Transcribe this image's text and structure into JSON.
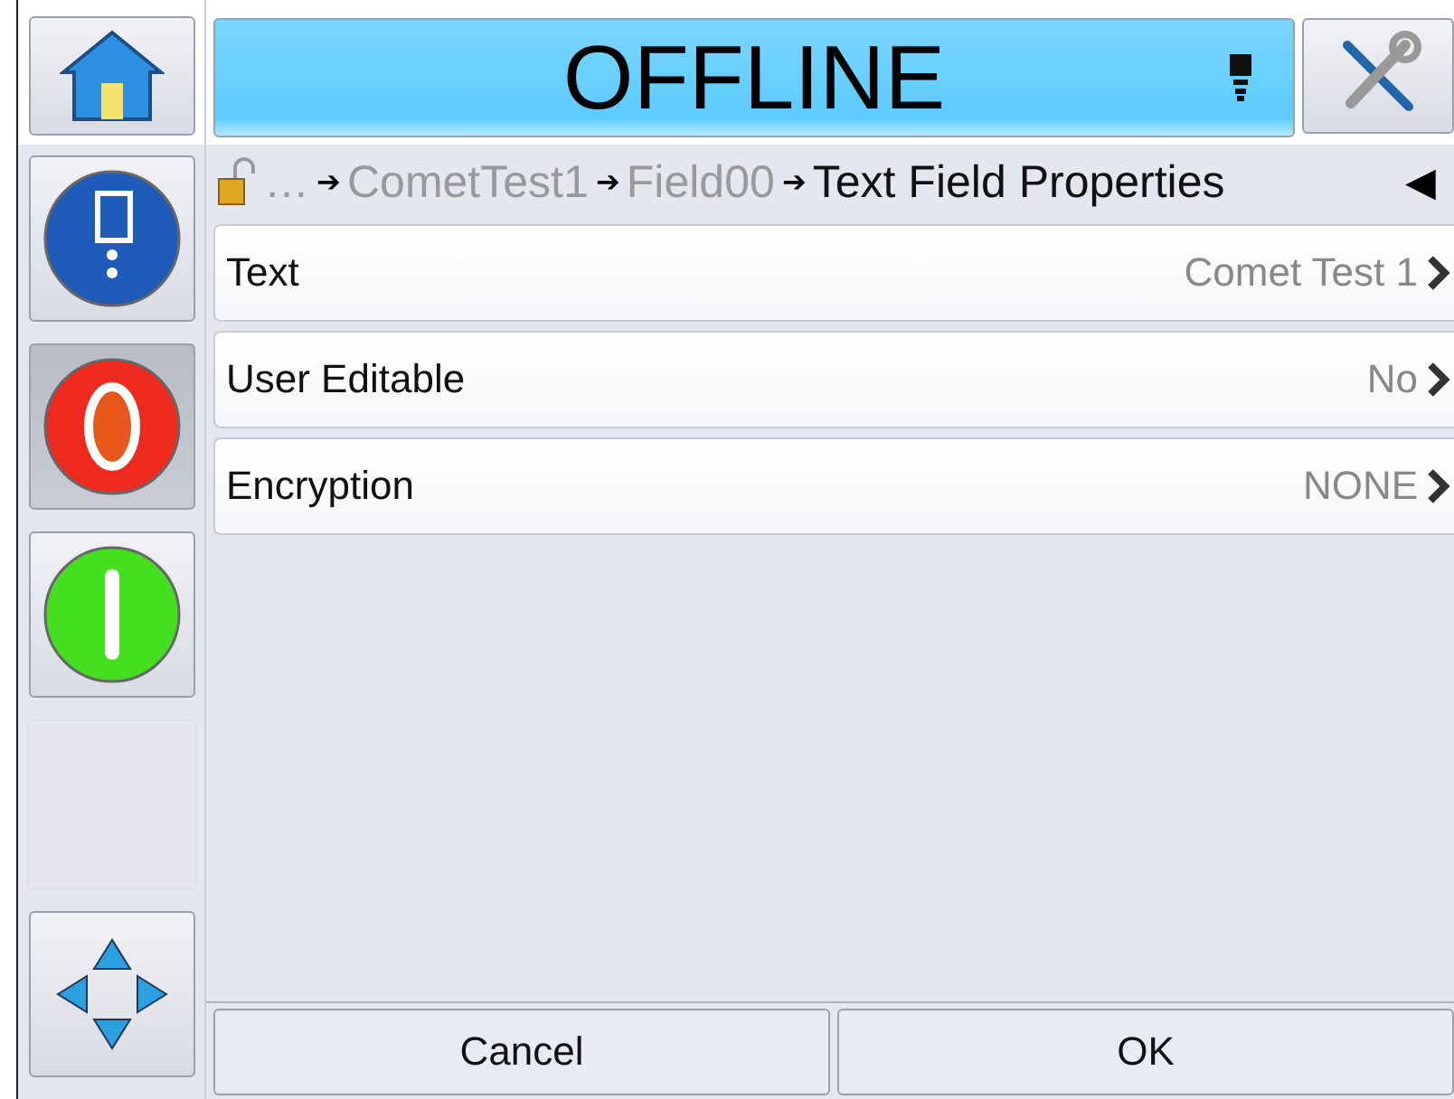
{
  "status": {
    "title": "OFFLINE"
  },
  "side_buttons": [
    {
      "kind": "ink",
      "pressed": false
    },
    {
      "kind": "stop",
      "pressed": true
    },
    {
      "kind": "start",
      "pressed": false
    },
    {
      "kind": "empty",
      "pressed": false
    },
    {
      "kind": "navigate",
      "pressed": false
    }
  ],
  "breadcrumb": {
    "separator": "➔",
    "back": "◀",
    "items": [
      {
        "label": "…",
        "current": false
      },
      {
        "label": "CometTest1",
        "current": false
      },
      {
        "label": "Field00",
        "current": false
      },
      {
        "label": "Text Field Properties",
        "current": true
      }
    ]
  },
  "properties": [
    {
      "label": "Text",
      "value": "Comet Test 1"
    },
    {
      "label": "User Editable",
      "value": "No"
    },
    {
      "label": "Encryption",
      "value": "NONE"
    }
  ],
  "buttons": [
    "Cancel",
    "OK"
  ]
}
